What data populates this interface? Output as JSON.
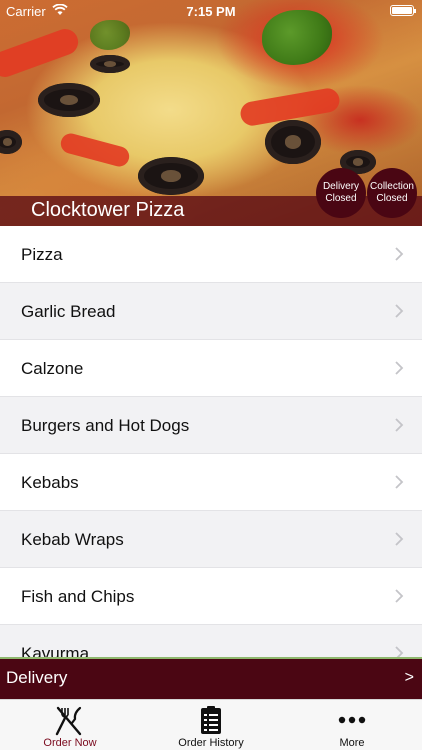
{
  "status_bar": {
    "carrier": "Carrier",
    "time": "7:15 PM"
  },
  "header": {
    "restaurant_name": "Clocktower Pizza",
    "delivery_badge": {
      "line1": "Delivery",
      "line2": "Closed"
    },
    "collection_badge": {
      "line1": "Collection",
      "line2": "Closed"
    }
  },
  "menu": {
    "items": [
      {
        "label": "Pizza"
      },
      {
        "label": "Garlic Bread"
      },
      {
        "label": "Calzone"
      },
      {
        "label": "Burgers and Hot Dogs"
      },
      {
        "label": "Kebabs"
      },
      {
        "label": "Kebab Wraps"
      },
      {
        "label": "Fish and Chips"
      },
      {
        "label": "Kavurma"
      }
    ]
  },
  "order_mode": {
    "label": "Delivery",
    "arrow": ">"
  },
  "tabbar": {
    "tabs": [
      {
        "label": "Order Now",
        "icon": "fork-knife-icon"
      },
      {
        "label": "Order History",
        "icon": "clipboard-list-icon"
      },
      {
        "label": "More",
        "icon": "more-dots-icon"
      }
    ]
  },
  "colors": {
    "brand": "#4b0613",
    "active_tab": "#7a0a1e",
    "row_alt": "#f2f2f4"
  }
}
